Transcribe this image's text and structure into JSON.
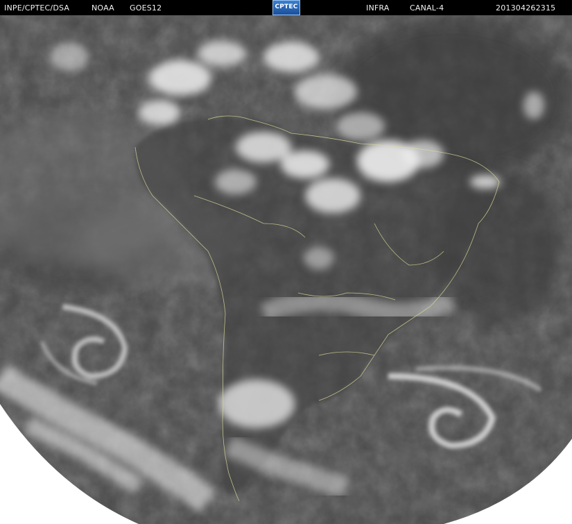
{
  "header": {
    "agency": "INPE/CPTEC/DSA",
    "provider": "NOAA",
    "satellite": "GOES12",
    "logo_text": "CPTEC",
    "band": "INFRA",
    "channel": "CANAL-4",
    "timestamp": "201304262315"
  },
  "colors": {
    "header_bg": "#000000",
    "header_text": "#f2f2f2",
    "space_bg": "#ffffff",
    "earth_base": "#4a4a4a",
    "cloud": "#f0f0f0",
    "coastline": "#e8e8a0"
  }
}
